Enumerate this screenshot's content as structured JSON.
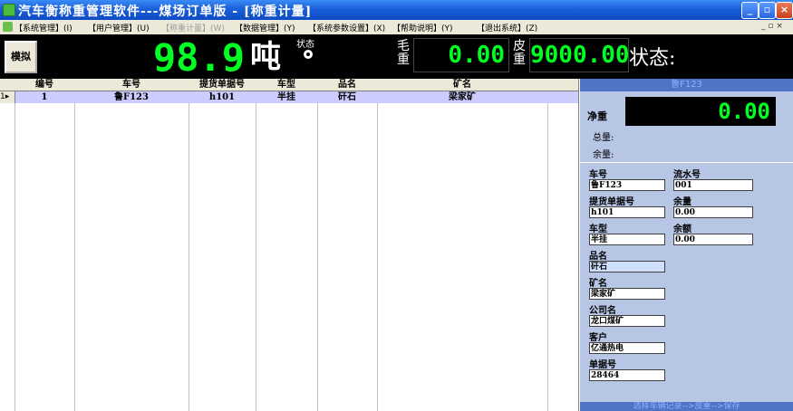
{
  "window": {
    "title": "汽车衡称重管理软件---煤场订单版 - [称重计量]"
  },
  "menu": {
    "items": [
      {
        "label": "【系统管理】(I)",
        "disabled": false
      },
      {
        "label": "【用户管理】(U)",
        "disabled": false
      },
      {
        "label": "【称重计量】(W)",
        "disabled": true
      },
      {
        "label": "【数据管理】(Y)",
        "disabled": false
      },
      {
        "label": "【系统参数设置】(X)",
        "disabled": false
      },
      {
        "label": "【帮助说明】(Y)",
        "disabled": false
      },
      {
        "label": "【退出系统】(Z)",
        "disabled": false
      }
    ],
    "mdi_controls": "_ ▫ ×"
  },
  "weigh": {
    "simulate_button": "模拟",
    "current_weight": "98.9",
    "unit": "吨",
    "status_label": "状态",
    "gross_label": "毛重",
    "gross_value": "0.00",
    "tare_label": "皮重",
    "tare_value": "9000.00",
    "state_text": "状态:"
  },
  "grid": {
    "columns": [
      "编号",
      "车号",
      "提货单据号",
      "车型",
      "品名",
      "矿名",
      ""
    ],
    "rows": [
      {
        "indicator": "1▸",
        "cells": [
          "1",
          "鲁F123",
          "h101",
          "半挂",
          "矸石",
          "梁家矿",
          ""
        ]
      }
    ]
  },
  "panel": {
    "header": "鲁F123",
    "net_label": "净重",
    "net_value": "0.00",
    "total_label": "总量:",
    "remain_label": "余量:",
    "fields": {
      "plate_label": "车号",
      "plate_value": "鲁F123",
      "serial_label": "流水号",
      "serial_value": "001",
      "bill_label": "提货单据号",
      "bill_value": "h101",
      "balance_label": "余量",
      "balance_value": "0.00",
      "type_label": "车型",
      "type_value": "半挂",
      "amount_label": "余额",
      "amount_value": "0.00",
      "product_label": "品名",
      "product_value": "矸石",
      "mine_label": "矿名",
      "mine_value": "梁家矿",
      "company_label": "公司名",
      "company_value": "龙口煤矿",
      "customer_label": "客户",
      "customer_value": "亿通热电",
      "doc_label": "单据号",
      "doc_value": "28464"
    },
    "footer": "选择车辆记录-->皮重-->保存"
  },
  "colors": {
    "title_blue": "#1a5fd8",
    "led_green": "#00ff22",
    "selected_row": "#ccccff",
    "panel_bg": "#b8c6e6",
    "panel_head": "#4e74c4"
  }
}
